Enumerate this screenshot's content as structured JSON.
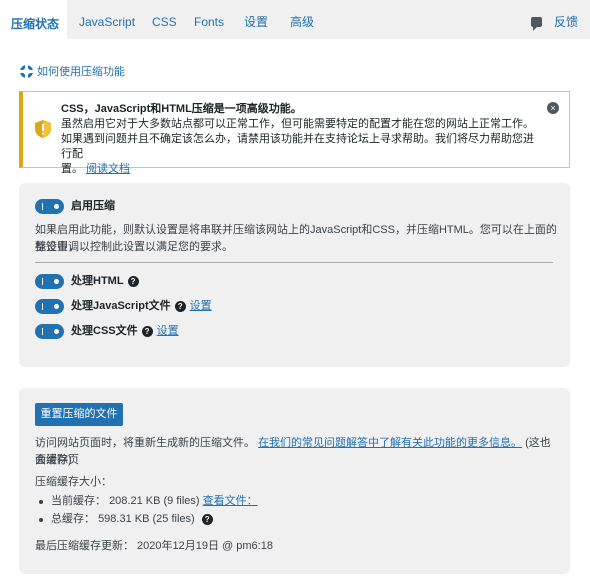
{
  "tabs": [
    {
      "label": "压缩状态",
      "active": true
    },
    {
      "label": "JavaScript",
      "active": false
    },
    {
      "label": "CSS",
      "active": false
    },
    {
      "label": "Fonts",
      "active": false
    },
    {
      "label": "设置",
      "active": false
    },
    {
      "label": "高级",
      "active": false
    }
  ],
  "feedback_label": "反馈",
  "help_link": "如何使用压缩功能",
  "notice": {
    "title": "CSS，JavaScript和HTML压缩是一项高级功能。",
    "line1": "虽然启用它对于大多数站点都可以正常工作，但可能需要特定的配置才能在您的网站上正常工作。",
    "line2": "如果遇到问题并且不确定该怎么办，请禁用该功能并在支持论坛上寻求帮助。我们将尽力帮助您进行配",
    "line3": "置。",
    "link": "阅读文档",
    "close": "×"
  },
  "minify": {
    "enable_label": "启用压缩",
    "description_1": "如果启用此功能，则默认设置是将串联并压缩该网站上的JavaScript和CSS，并压缩HTML。您可以在上面的标签中调",
    "description_2": "整设置，以控制此设置以满足您的要求。",
    "process_html": "处理HTML",
    "process_js": "处理JavaScript文件",
    "process_css": "处理CSS文件",
    "settings_link": "设置",
    "help": "?"
  },
  "cache": {
    "reset_button": "重置压缩的文件",
    "visit_text": "访问网站页面时，将重新生成新的压缩文件。",
    "faq_link": "在我们的常见问题解答中了解有关此功能的更多信息。",
    "visit_suffix_1": "(这也会清除页",
    "visit_suffix_2": "面缓存)",
    "size_title": "压缩缓存大小：",
    "current_label": "当前缓存：",
    "current_value": "208.21 KB (9 files)",
    "view_files": "查看文件：",
    "total_label": "总缓存：",
    "total_value": "598.31 KB (25 files)",
    "last_update": "最后压缩缓存更新： 2020年12月19日 @ pm6:18"
  },
  "colors": {
    "accent": "#2271b1",
    "warning": "#dba617",
    "panel_bg": "#f0f0f1"
  }
}
